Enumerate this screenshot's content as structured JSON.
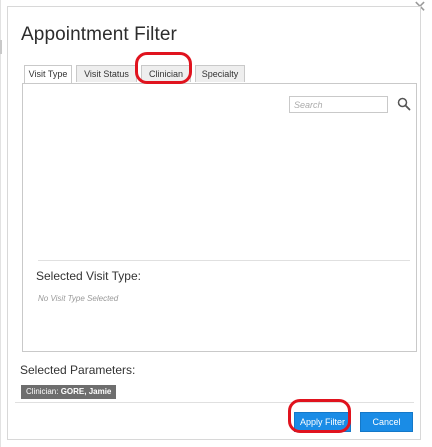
{
  "dialog": {
    "title": "Appointment Filter",
    "close_icon": "close-icon"
  },
  "tabs": [
    {
      "label": "Visit Type",
      "active": true
    },
    {
      "label": "Visit Status",
      "active": false
    },
    {
      "label": "Clinician",
      "active": false
    },
    {
      "label": "Specialty",
      "active": false
    }
  ],
  "panel": {
    "search_placeholder": "Search",
    "search_icon": "search-icon",
    "selected_heading": "Selected Visit Type:",
    "empty_note": "No Visit Type Selected"
  },
  "parameters": {
    "heading": "Selected Parameters:",
    "chip_prefix": "Clinician:",
    "chip_value": "GORE, Jamie"
  },
  "buttons": {
    "apply": "Apply Filter",
    "cancel": "Cancel"
  },
  "colors": {
    "primary_button": "#1a8ce6",
    "highlight": "#e0131e",
    "chip_bg": "#6e6e6e"
  }
}
